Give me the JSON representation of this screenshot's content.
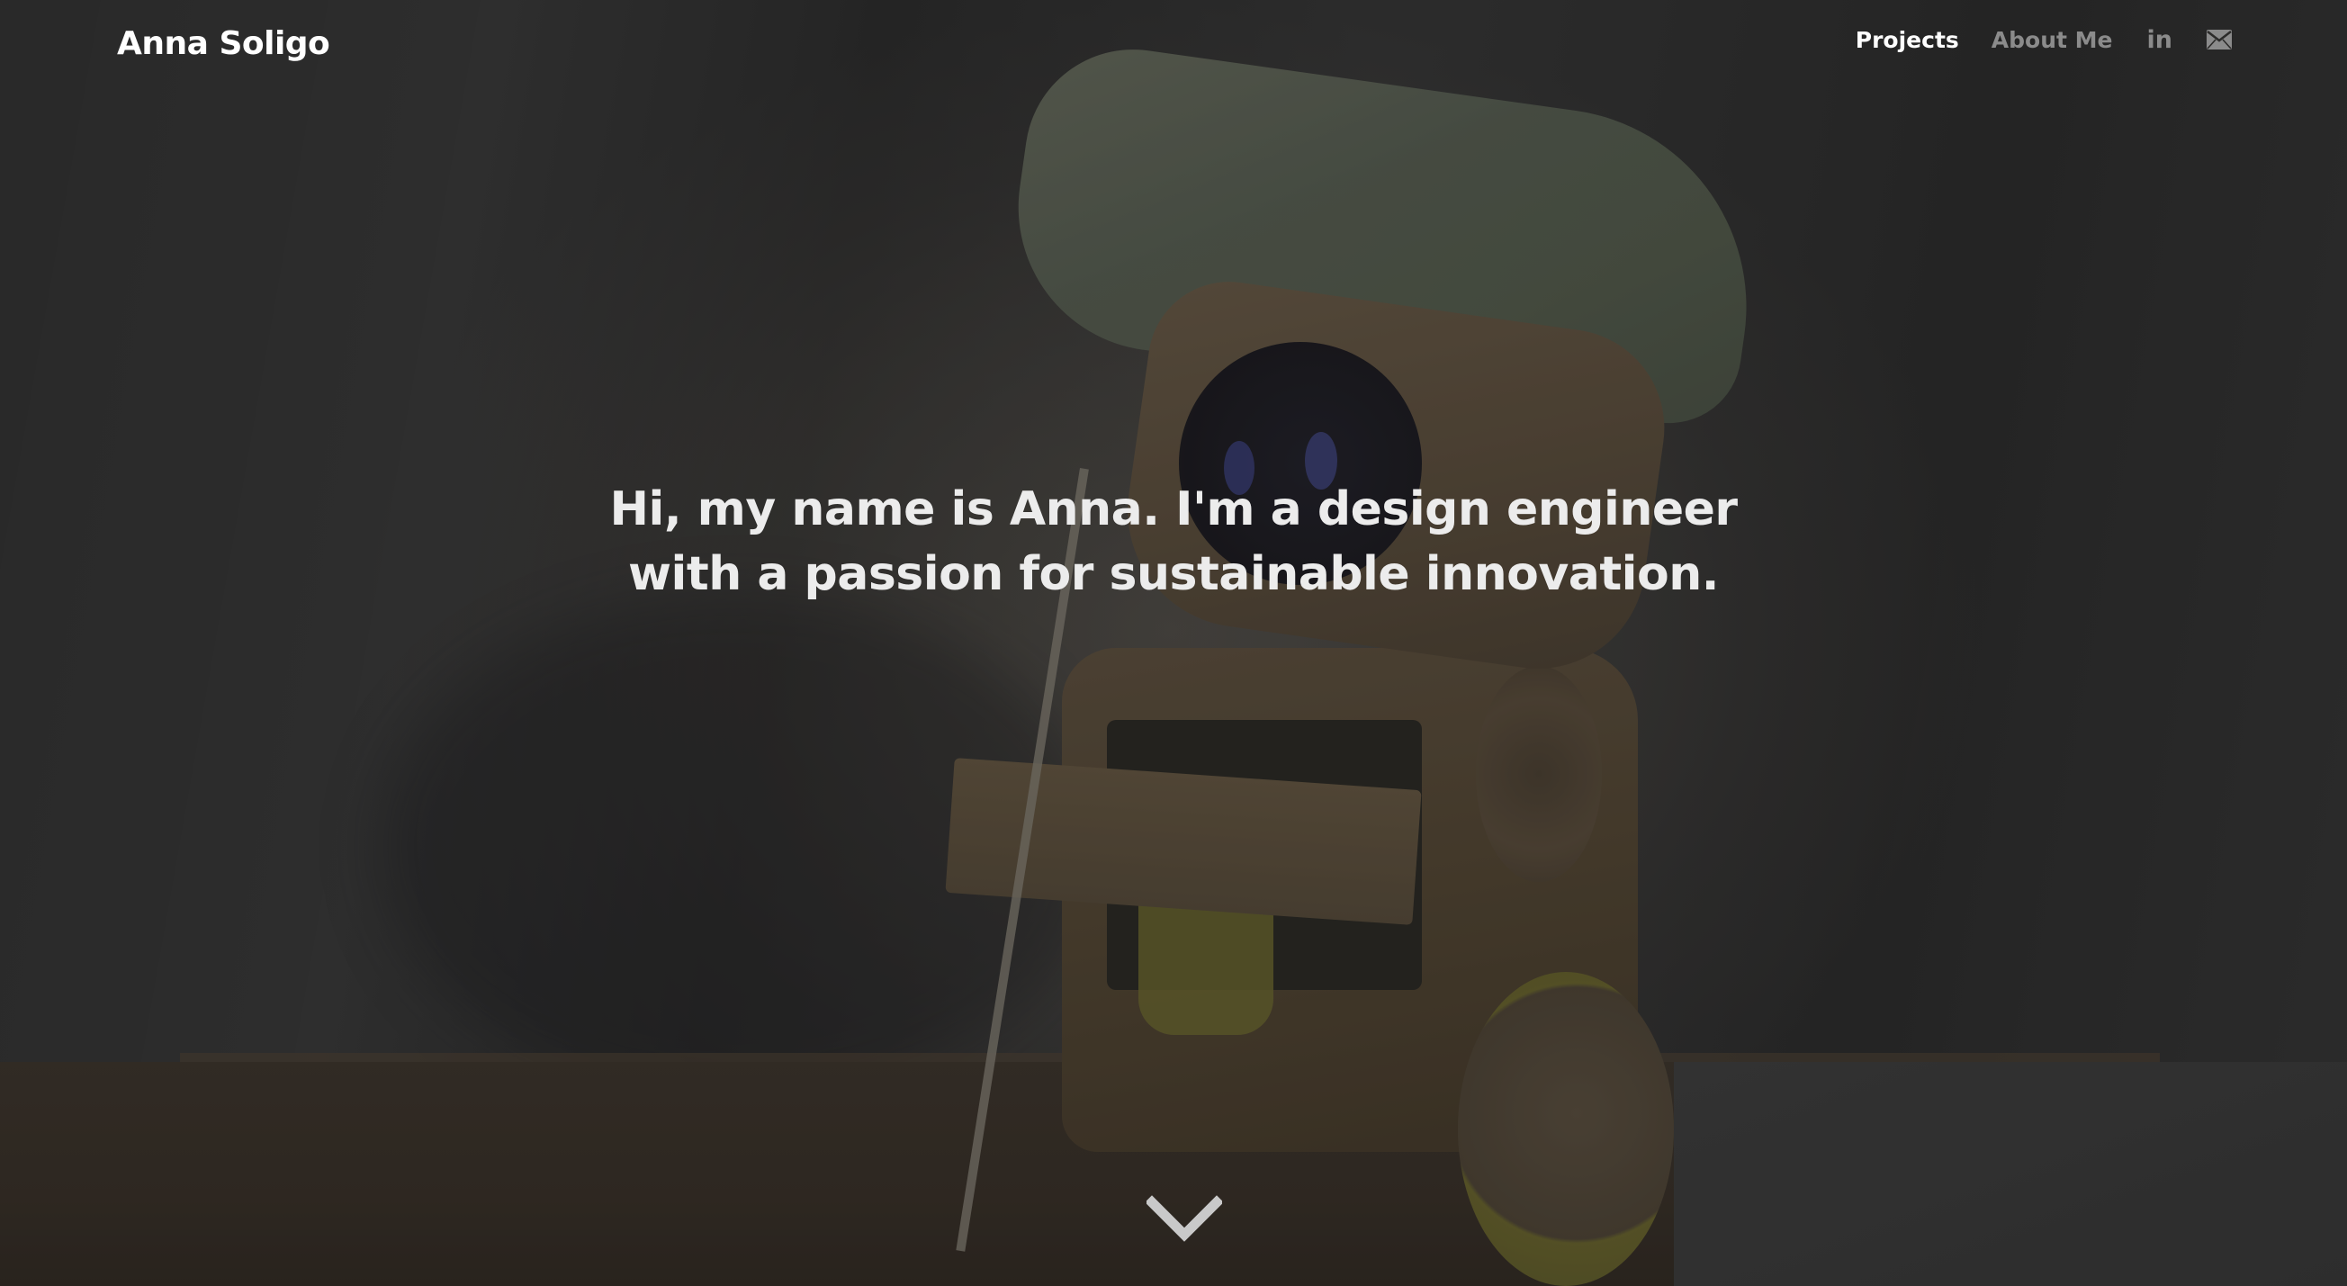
{
  "header": {
    "brand": "Anna Soligo",
    "nav": [
      {
        "label": "Projects",
        "active": true
      },
      {
        "label": "About Me",
        "active": false
      }
    ],
    "icons": [
      {
        "name": "linkedin-icon",
        "glyph": "in"
      },
      {
        "name": "mail-icon"
      }
    ]
  },
  "hero": {
    "headline_line1": "Hi, my name is Anna. I'm a design engineer",
    "headline_line2": "with a passion for sustainable innovation.",
    "scroll_icon": "chevron-down-icon"
  },
  "colors": {
    "text_primary": "#ffffff",
    "text_muted": "#8b8b8b",
    "headline": "#ececec"
  }
}
